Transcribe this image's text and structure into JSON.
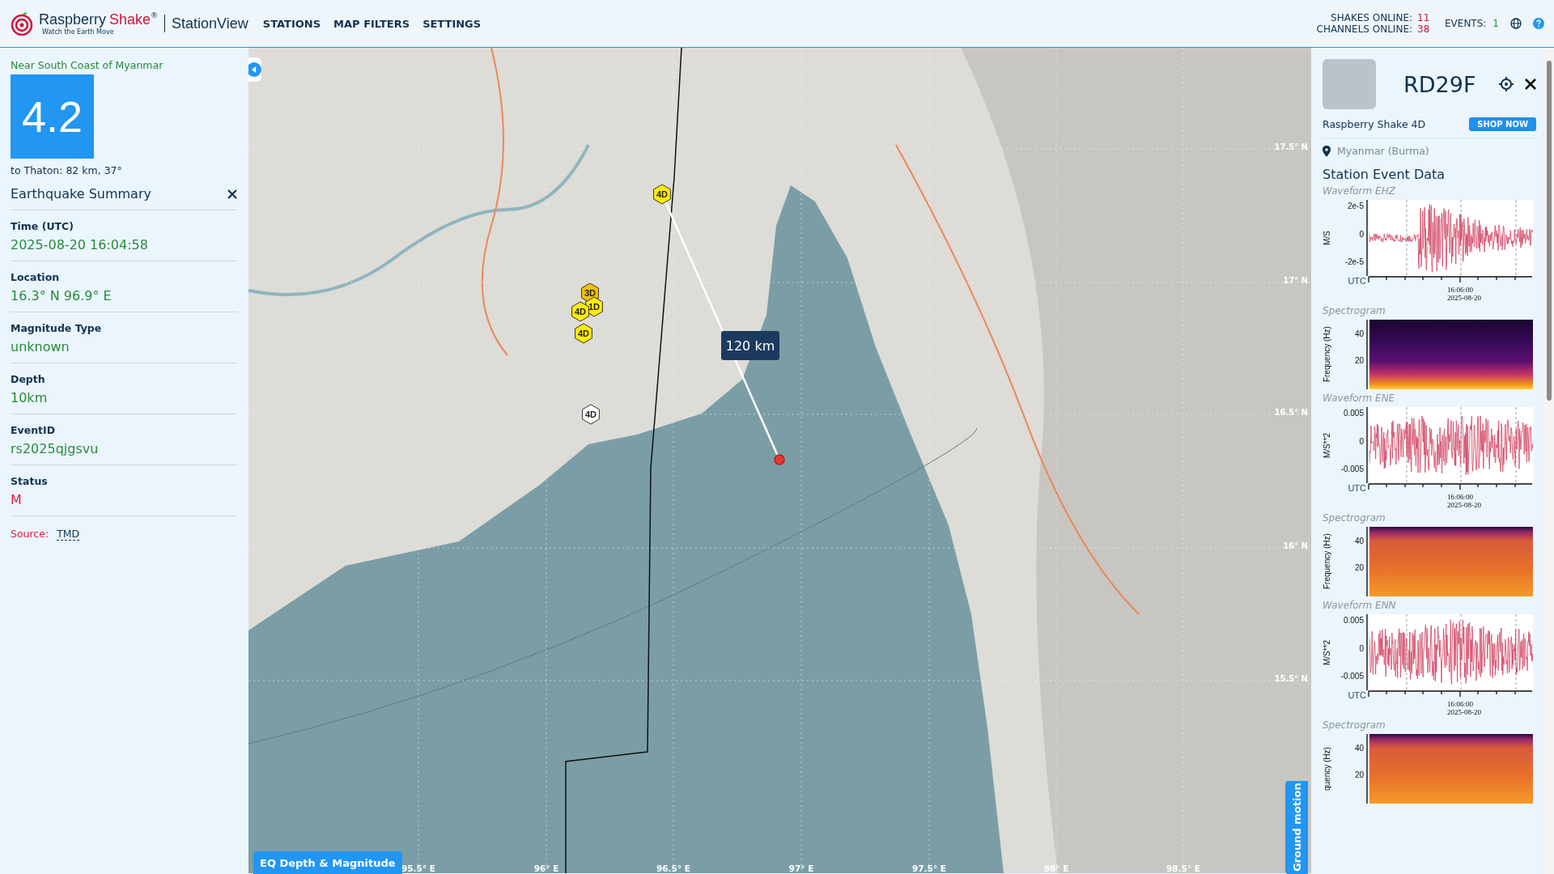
{
  "header": {
    "brand_name": "Raspberry",
    "brand_accent": "Shake",
    "registered": "®",
    "app_name": "StationView",
    "tagline": "Watch the Earth Move",
    "nav": [
      "STATIONS",
      "MAP FILTERS",
      "SETTINGS"
    ],
    "stats": [
      {
        "label": "SHAKES ONLINE:",
        "value": "11"
      },
      {
        "label": "CHANNELS ONLINE:",
        "value": "38"
      }
    ],
    "events": {
      "label": "EVENTS:",
      "value": "1"
    }
  },
  "event": {
    "region": "Near South Coast of Myanmar",
    "magnitude": "4.2",
    "distance": "to Thaton: 82 km, 37°",
    "summary_title": "Earthquake Summary",
    "fields": [
      {
        "label": "Time (UTC)",
        "value": "2025-08-20 16:04:58",
        "kind": "value"
      },
      {
        "label": "Location",
        "value": "16.3° N 96.9° E",
        "kind": "value"
      },
      {
        "label": "Magnitude Type",
        "value": "unknown",
        "kind": "value"
      },
      {
        "label": "Depth",
        "value": "10km",
        "kind": "value"
      },
      {
        "label": "EventID",
        "value": "rs2025qjgsvu",
        "kind": "value"
      },
      {
        "label": "Status",
        "value": "M",
        "kind": "status"
      }
    ],
    "source": {
      "label": "Source:",
      "value": "TMD"
    }
  },
  "map": {
    "distance_label": "120 km",
    "stations": [
      {
        "label": "4D",
        "color": "#ffee00"
      },
      {
        "label": "3D",
        "color": "#f5c200"
      },
      {
        "label": "1D",
        "color": "#ffee00"
      },
      {
        "label": "4D",
        "color": "#ffee00"
      },
      {
        "label": "4D",
        "color": "#ffee00"
      },
      {
        "label": "4D",
        "color": "#ffffff"
      }
    ],
    "longitudes": [
      "95.5° E",
      "96° E",
      "96.5° E",
      "97° E",
      "97.5° E",
      "98° E",
      "98.5° E"
    ],
    "latitudes": [
      "17.5° N",
      "17° N",
      "16.5° N",
      "16° N",
      "15.5° N"
    ],
    "depth_button": "EQ Depth & Magnitude",
    "ground_motion_tab": "Ground motion"
  },
  "station": {
    "name": "RD29F",
    "model": "Raspberry Shake 4D",
    "shop_button": "SHOP NOW",
    "location": "Myanmar (Burma)",
    "section_title": "Station Event Data",
    "plots": [
      {
        "kind": "waveform",
        "title": "Waveform EHZ",
        "ylabel": "M/S",
        "yticks": [
          "2e-5",
          "0",
          "-2e-5"
        ],
        "xlabel": "UTC",
        "time": "16:06:00",
        "date": "2025-08-20"
      },
      {
        "kind": "spectrogram",
        "title": "Spectrogram",
        "ylabel": "Frequency (Hz)",
        "yticks": [
          "40",
          "20"
        ]
      },
      {
        "kind": "waveform",
        "title": "Waveform ENE",
        "ylabel": "M/S**2",
        "yticks": [
          "0.005",
          "0",
          "-0.005"
        ],
        "xlabel": "UTC",
        "time": "16:06:00",
        "date": "2025-08-20"
      },
      {
        "kind": "spectrogram",
        "title": "Spectrogram",
        "ylabel": "Frequency (Hz)",
        "yticks": [
          "40",
          "20"
        ]
      },
      {
        "kind": "waveform",
        "title": "Waveform ENN",
        "ylabel": "M/S**2",
        "yticks": [
          "0.005",
          "0",
          "-0.005"
        ],
        "xlabel": "UTC",
        "time": "16:06:00",
        "date": "2025-08-20"
      },
      {
        "kind": "spectrogram",
        "title": "Spectrogram",
        "ylabel": "quency (Hz)",
        "yticks": [
          "40",
          "20"
        ]
      }
    ]
  }
}
